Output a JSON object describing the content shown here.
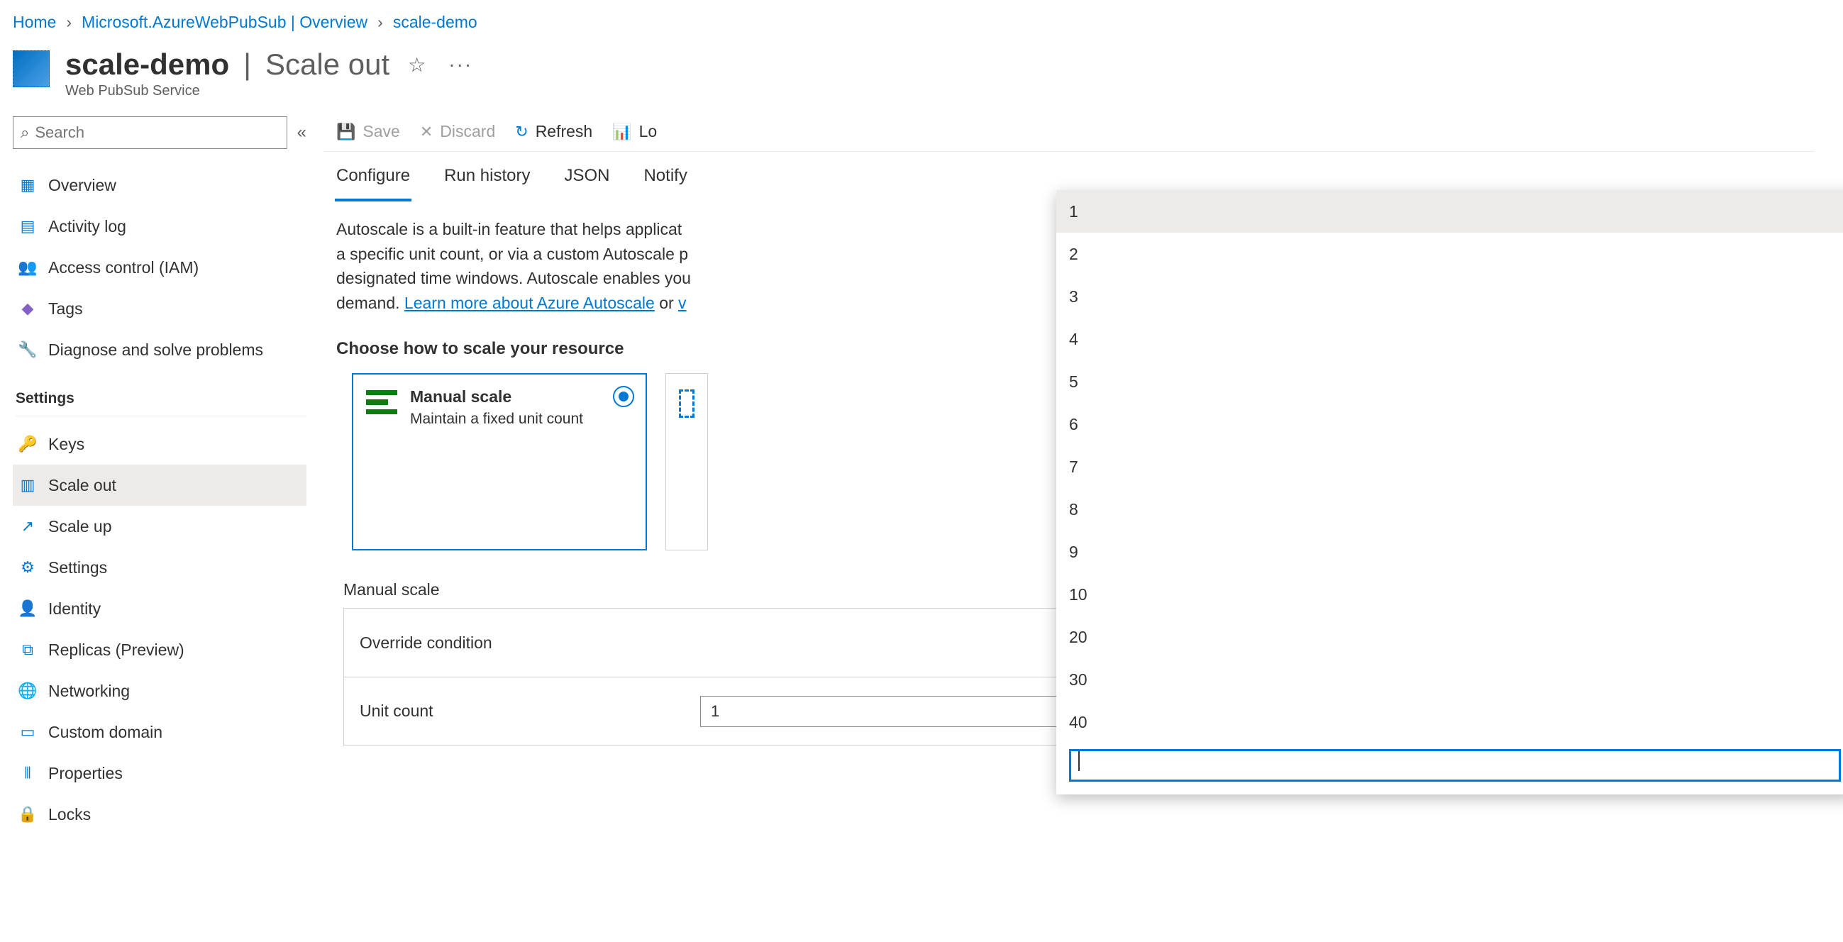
{
  "breadcrumb": {
    "home": "Home",
    "l1": "Microsoft.AzureWebPubSub | Overview",
    "l2": "scale-demo"
  },
  "page": {
    "name": "scale-demo",
    "section": "Scale out",
    "type": "Web PubSub Service"
  },
  "search": {
    "placeholder": "Search"
  },
  "nav": {
    "top": {
      "overview": {
        "label": "Overview",
        "icon": "▦",
        "color": "#0078d4"
      },
      "activity": {
        "label": "Activity log",
        "icon": "▤",
        "color": "#0078d4"
      },
      "access": {
        "label": "Access control (IAM)",
        "icon": "👥",
        "color": "#d13438"
      },
      "tags": {
        "label": "Tags",
        "icon": "◆",
        "color": "#8661c5"
      },
      "diagnose": {
        "label": "Diagnose and solve problems",
        "icon": "🔧",
        "color": "#605e5c"
      }
    },
    "settingsHeader": "Settings",
    "settings": {
      "keys": {
        "label": "Keys",
        "icon": "🔑",
        "color": "#f2c811"
      },
      "scaleout": {
        "label": "Scale out",
        "icon": "▥",
        "color": "#0078d4"
      },
      "scaleup": {
        "label": "Scale up",
        "icon": "↗",
        "color": "#0078d4"
      },
      "settings": {
        "label": "Settings",
        "icon": "⚙",
        "color": "#0078d4"
      },
      "identity": {
        "label": "Identity",
        "icon": "👤",
        "color": "#f2c811"
      },
      "replicas": {
        "label": "Replicas (Preview)",
        "icon": "⧉",
        "color": "#0078d4"
      },
      "networking": {
        "label": "Networking",
        "icon": "🌐",
        "color": "#107c10"
      },
      "custom": {
        "label": "Custom domain",
        "icon": "▭",
        "color": "#0078d4"
      },
      "properties": {
        "label": "Properties",
        "icon": "⦀",
        "color": "#0078d4"
      },
      "locks": {
        "label": "Locks",
        "icon": "🔒",
        "color": "#0078d4"
      }
    }
  },
  "toolbar": {
    "save": "Save",
    "discard": "Discard",
    "refresh": "Refresh",
    "logs_partial": "Lo"
  },
  "tabs": {
    "configure": "Configure",
    "run": "Run history",
    "json": "JSON",
    "notify": "Notify"
  },
  "description": {
    "t1": "Autoscale is a built-in feature that helps applicat",
    "t2": "a specific unit count, or via a custom Autoscale p",
    "t3": "designated time windows. Autoscale enables you",
    "t4": "demand. ",
    "link": "Learn more about Azure Autoscale",
    "t5": " or ",
    "link2_partial": "v"
  },
  "choose": {
    "header": "Choose how to scale your resource"
  },
  "cards": {
    "manual": {
      "title": "Manual scale",
      "sub": "Maintain a fixed unit count"
    }
  },
  "section": {
    "manual": "Manual scale"
  },
  "form": {
    "override": "Override condition",
    "unitcount": "Unit count",
    "unitcountValue": "1"
  },
  "dropdown": {
    "options": [
      "1",
      "2",
      "3",
      "4",
      "5",
      "6",
      "7",
      "8",
      "9",
      "10",
      "20",
      "30",
      "40"
    ],
    "selected": "1"
  }
}
